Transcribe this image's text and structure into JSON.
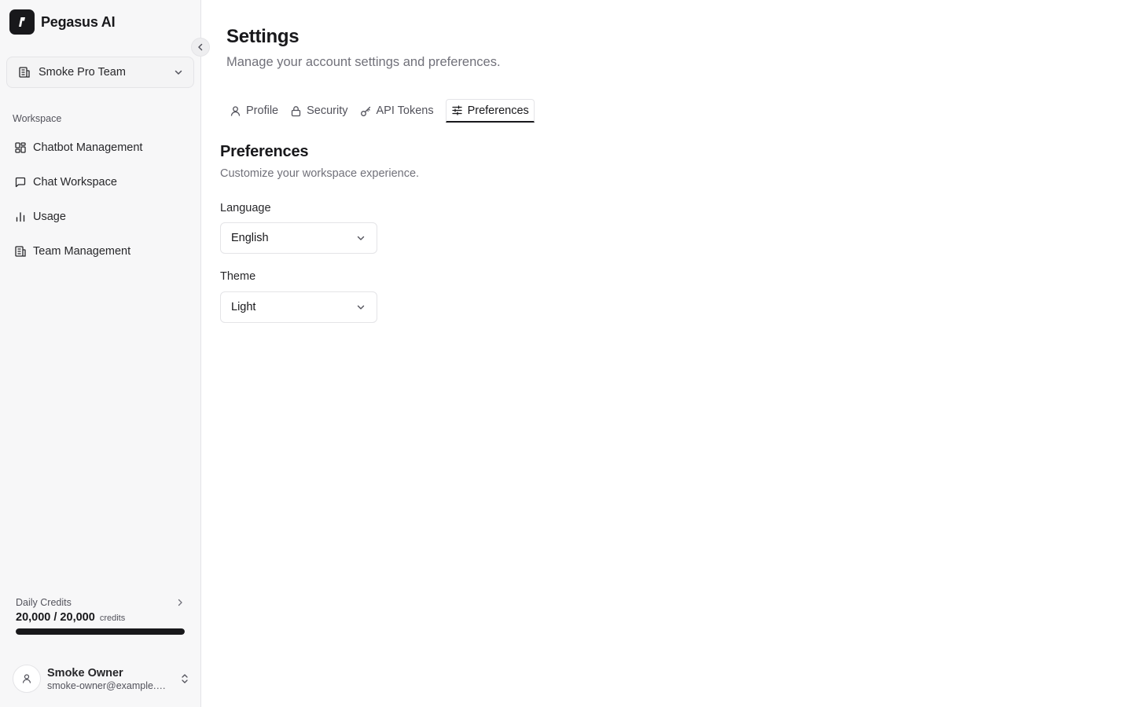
{
  "app": {
    "name": "Pegasus AI"
  },
  "sidebar": {
    "team": {
      "name": "Smoke Pro Team"
    },
    "section_label": "Workspace",
    "items": [
      {
        "label": "Chatbot Management",
        "icon": "layout-grid-icon"
      },
      {
        "label": "Chat Workspace",
        "icon": "message-square-icon"
      },
      {
        "label": "Usage",
        "icon": "bar-chart-icon"
      },
      {
        "label": "Team Management",
        "icon": "building-icon"
      }
    ],
    "credits": {
      "label": "Daily Credits",
      "amount": "20,000 / 20,000",
      "unit": "credits",
      "fraction": 1.0
    },
    "user": {
      "name": "Smoke Owner",
      "email": "smoke-owner@example.com"
    }
  },
  "page": {
    "title": "Settings",
    "subtitle": "Manage your account settings and preferences."
  },
  "tabs": [
    {
      "label": "Profile",
      "icon": "user-icon",
      "active": false
    },
    {
      "label": "Security",
      "icon": "lock-icon",
      "active": false
    },
    {
      "label": "API Tokens",
      "icon": "key-icon",
      "active": false
    },
    {
      "label": "Preferences",
      "icon": "sliders-icon",
      "active": true
    }
  ],
  "preferences": {
    "title": "Preferences",
    "description": "Customize your workspace experience.",
    "language": {
      "label": "Language",
      "value": "English"
    },
    "theme": {
      "label": "Theme",
      "value": "Light"
    }
  },
  "colors": {
    "sidebar_bg": "#f7f7f8",
    "text_primary": "#18181b",
    "text_muted": "#71717a",
    "border": "#e4e4e7",
    "accent": "#18181b"
  }
}
